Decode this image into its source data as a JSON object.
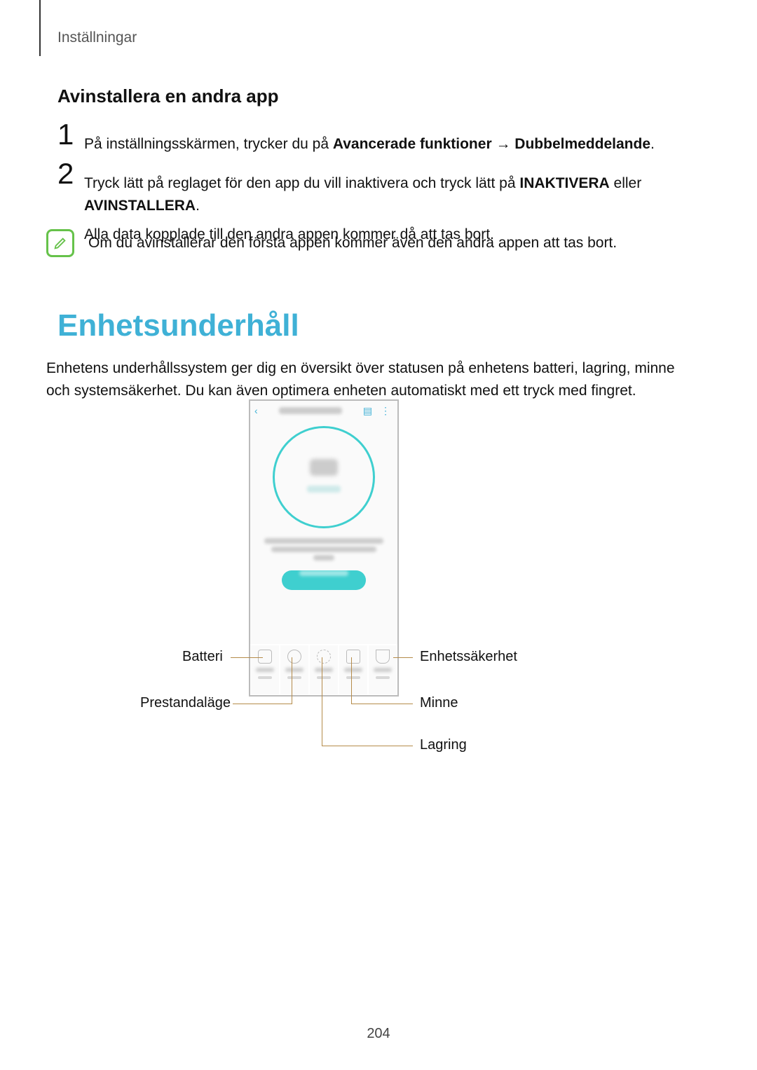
{
  "breadcrumb": "Inställningar",
  "section": {
    "title": "Avinstallera en andra app"
  },
  "step1": {
    "num": "1",
    "t1": "På inställningsskärmen, trycker du på ",
    "b1": "Avancerade funktioner",
    "arrow": " → ",
    "b2": "Dubbelmeddelande",
    "end": "."
  },
  "step2": {
    "num": "2",
    "t1": "Tryck lätt på reglaget för den app du vill inaktivera och tryck lätt på ",
    "b1": "INAKTIVERA",
    "mid": " eller ",
    "b2": "AVINSTALLERA",
    "end": ".",
    "t2": "Alla data kopplade till den andra appen kommer då att tas bort."
  },
  "note": {
    "text": "Om du avinstallerar den första appen kommer även den andra appen att tas bort."
  },
  "main": {
    "heading": "Enhetsunderhåll",
    "body": "Enhetens underhållssystem ger dig en översikt över statusen på enhetens batteri, lagring, minne och systemsäkerhet. Du kan även optimera enheten automatiskt med ett tryck med fingret."
  },
  "callouts": {
    "battery": "Batteri",
    "perf": "Prestandaläge",
    "storage": "Lagring",
    "memory": "Minne",
    "security": "Enhetssäkerhet"
  },
  "pageno": "204"
}
